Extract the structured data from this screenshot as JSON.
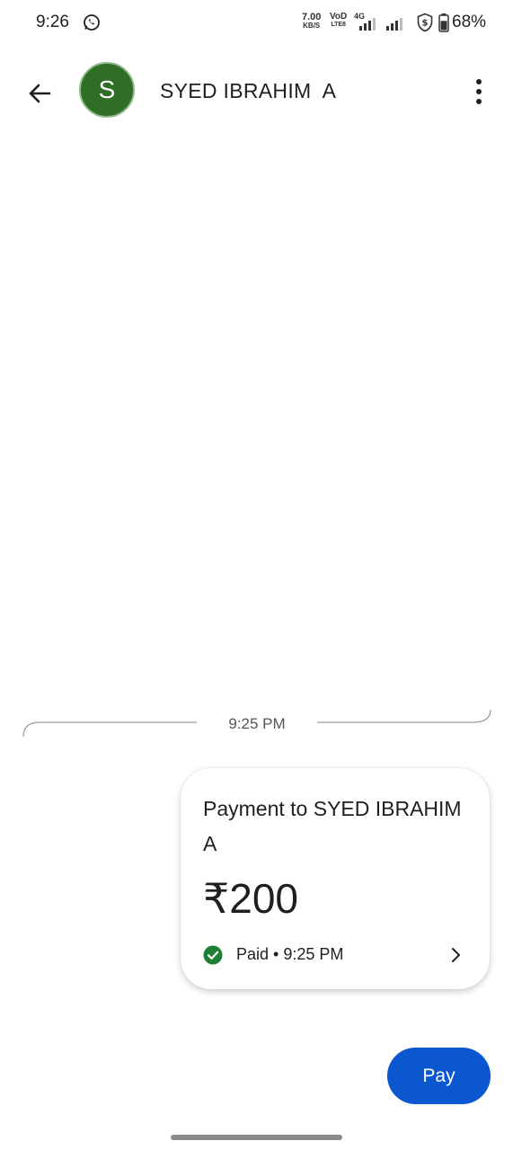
{
  "status_bar": {
    "time": "9:26",
    "speed_value": "7.00",
    "speed_unit": "KB/S",
    "volte_top": "VoD",
    "volte_bottom": "LTE8",
    "network_type": "4G",
    "battery_percent": "68%",
    "battery_level": 0.68
  },
  "header": {
    "avatar_initial": "S",
    "contact_name": "SYED IBRAHIM  A"
  },
  "conversation": {
    "divider_time": "9:25 PM",
    "payment_card": {
      "title": "Payment to SYED IBRAHIM  A",
      "amount": "₹200",
      "status": "Paid • 9:25 PM"
    }
  },
  "actions": {
    "pay_label": "Pay"
  },
  "colors": {
    "avatar": "#2f6e25",
    "primary_button": "#0b57d0",
    "paid_check": "#1e7e34"
  }
}
